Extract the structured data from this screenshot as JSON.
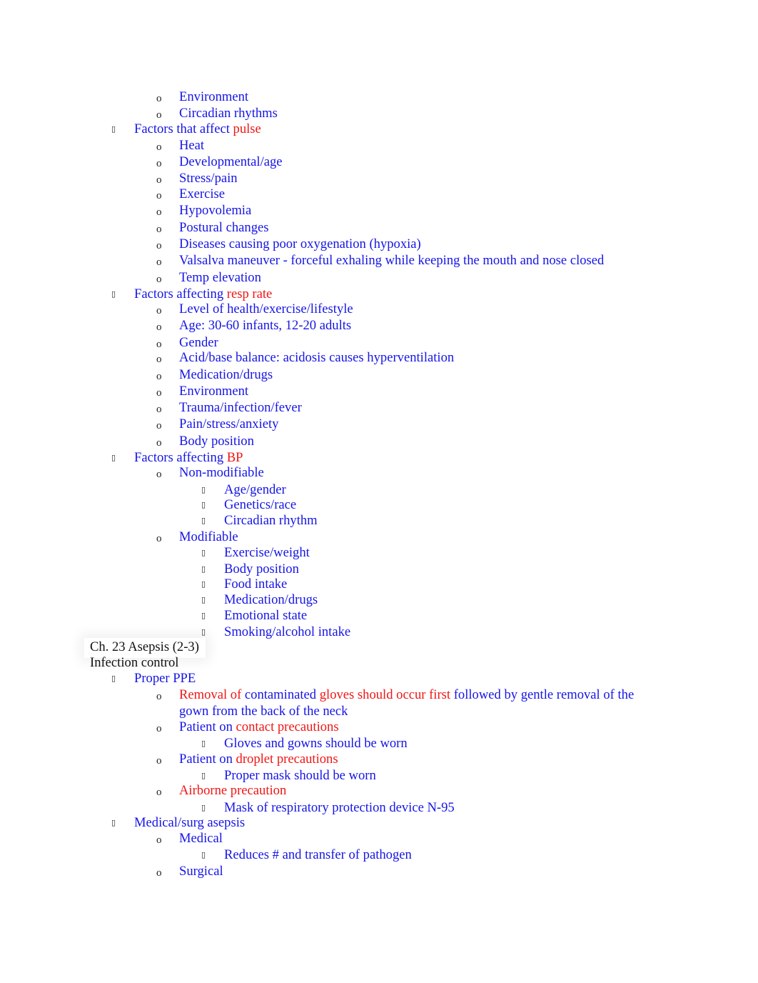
{
  "document": {
    "lines": [
      {
        "level": 2,
        "segments": [
          {
            "text": "Environment",
            "color": "blue"
          }
        ]
      },
      {
        "level": 2,
        "segments": [
          {
            "text": "Circadian rhythms",
            "color": "blue"
          }
        ]
      },
      {
        "level": 1,
        "segments": [
          {
            "text": "Factors that affect ",
            "color": "blue"
          },
          {
            "text": "pulse",
            "color": "red"
          }
        ]
      },
      {
        "level": 2,
        "segments": [
          {
            "text": "Heat",
            "color": "blue"
          }
        ]
      },
      {
        "level": 2,
        "segments": [
          {
            "text": "Developmental/age",
            "color": "blue"
          }
        ]
      },
      {
        "level": 2,
        "segments": [
          {
            "text": "Stress/pain",
            "color": "blue"
          }
        ]
      },
      {
        "level": 2,
        "segments": [
          {
            "text": "Exercise",
            "color": "blue"
          }
        ]
      },
      {
        "level": 2,
        "segments": [
          {
            "text": "Hypovolemia",
            "color": "blue"
          }
        ]
      },
      {
        "level": 2,
        "segments": [
          {
            "text": "Postural changes",
            "color": "blue"
          }
        ]
      },
      {
        "level": 2,
        "segments": [
          {
            "text": "Diseases causing poor oxygenation (hypoxia)",
            "color": "blue"
          }
        ]
      },
      {
        "level": 2,
        "segments": [
          {
            "text": "Valsalva maneuver - forceful exhaling while keeping the mouth and nose closed",
            "color": "blue"
          }
        ]
      },
      {
        "level": 2,
        "segments": [
          {
            "text": "Temp elevation",
            "color": "blue"
          }
        ]
      },
      {
        "level": 1,
        "segments": [
          {
            "text": "Factors affecting ",
            "color": "blue"
          },
          {
            "text": "resp rate",
            "color": "red"
          }
        ]
      },
      {
        "level": 2,
        "segments": [
          {
            "text": "Level of health/exercise/lifestyle",
            "color": "blue"
          }
        ]
      },
      {
        "level": 2,
        "segments": [
          {
            "text": "Age: 30-60 infants, 12-20 adults",
            "color": "blue"
          }
        ]
      },
      {
        "level": 2,
        "segments": [
          {
            "text": "Gender",
            "color": "blue"
          }
        ]
      },
      {
        "level": 2,
        "segments": [
          {
            "text": "Acid/base balance: acidosis causes hyperventilation",
            "color": "blue"
          }
        ]
      },
      {
        "level": 2,
        "segments": [
          {
            "text": "Medication/drugs",
            "color": "blue"
          }
        ]
      },
      {
        "level": 2,
        "segments": [
          {
            "text": "Environment",
            "color": "blue"
          }
        ]
      },
      {
        "level": 2,
        "segments": [
          {
            "text": "Trauma/infection/fever",
            "color": "blue"
          }
        ]
      },
      {
        "level": 2,
        "segments": [
          {
            "text": "Pain/stress/anxiety",
            "color": "blue"
          }
        ]
      },
      {
        "level": 2,
        "segments": [
          {
            "text": "Body position",
            "color": "blue"
          }
        ]
      },
      {
        "level": 1,
        "segments": [
          {
            "text": "Factors affecting ",
            "color": "blue"
          },
          {
            "text": "BP",
            "color": "red"
          }
        ]
      },
      {
        "level": 2,
        "segments": [
          {
            "text": "Non-modifiable",
            "color": "blue"
          }
        ]
      },
      {
        "level": 3,
        "segments": [
          {
            "text": "Age/gender",
            "color": "blue"
          }
        ]
      },
      {
        "level": 3,
        "segments": [
          {
            "text": "Genetics/race",
            "color": "blue"
          }
        ]
      },
      {
        "level": 3,
        "segments": [
          {
            "text": "Circadian rhythm",
            "color": "blue"
          }
        ]
      },
      {
        "level": 2,
        "segments": [
          {
            "text": "Modifiable",
            "color": "blue"
          }
        ]
      },
      {
        "level": 3,
        "segments": [
          {
            "text": "Exercise/weight",
            "color": "blue"
          }
        ]
      },
      {
        "level": 3,
        "segments": [
          {
            "text": "Body position",
            "color": "blue"
          }
        ]
      },
      {
        "level": 3,
        "segments": [
          {
            "text": "Food intake",
            "color": "blue"
          }
        ]
      },
      {
        "level": 3,
        "segments": [
          {
            "text": "Medication/drugs",
            "color": "blue"
          }
        ]
      },
      {
        "level": 3,
        "segments": [
          {
            "text": "Emotional state",
            "color": "blue"
          }
        ]
      },
      {
        "level": 3,
        "segments": [
          {
            "text": "Smoking/alcohol intake",
            "color": "blue"
          }
        ]
      },
      {
        "level": 0,
        "segments": [
          {
            "text": "Ch. 23 Asepsis (2-3)",
            "color": "black"
          }
        ]
      },
      {
        "level": 0,
        "segments": [
          {
            "text": "Infection control",
            "color": "black"
          }
        ]
      },
      {
        "level": 1,
        "segments": [
          {
            "text": "Proper PPE",
            "color": "blue"
          }
        ]
      },
      {
        "level": 2,
        "segments": [
          {
            "text": "Removal of ",
            "color": "red"
          },
          {
            "text": "contaminated ",
            "color": "blue"
          },
          {
            "text": "gloves should occur first ",
            "color": "red"
          },
          {
            "text": "followed by gentle removal of the",
            "color": "blue"
          }
        ]
      },
      {
        "level": 2,
        "continuation": true,
        "segments": [
          {
            "text": "gown from the back of the neck",
            "color": "blue"
          }
        ]
      },
      {
        "level": 2,
        "segments": [
          {
            "text": "Patient on ",
            "color": "blue"
          },
          {
            "text": "contact precautions",
            "color": "red"
          }
        ]
      },
      {
        "level": 3,
        "segments": [
          {
            "text": "Gloves and gowns should be worn",
            "color": "blue"
          }
        ]
      },
      {
        "level": 2,
        "segments": [
          {
            "text": "Patient on ",
            "color": "blue"
          },
          {
            "text": "droplet precautions",
            "color": "red"
          }
        ]
      },
      {
        "level": 3,
        "segments": [
          {
            "text": "Proper mask should be worn",
            "color": "blue"
          }
        ]
      },
      {
        "level": 2,
        "segments": [
          {
            "text": "Airborne precaution",
            "color": "red"
          }
        ]
      },
      {
        "level": 3,
        "segments": [
          {
            "text": "Mask of respiratory protection device N-95",
            "color": "blue"
          }
        ]
      },
      {
        "level": 1,
        "segments": [
          {
            "text": "Medical/surg asepsis",
            "color": "blue"
          }
        ]
      },
      {
        "level": 2,
        "segments": [
          {
            "text": "Medical",
            "color": "blue"
          }
        ]
      },
      {
        "level": 3,
        "segments": [
          {
            "text": "Reduces # and transfer of pathogen",
            "color": "blue"
          }
        ]
      },
      {
        "level": 2,
        "segments": [
          {
            "text": "Surgical",
            "color": "blue"
          }
        ]
      }
    ],
    "bullets": {
      "1": "",
      "2": "o",
      "3": ""
    }
  }
}
